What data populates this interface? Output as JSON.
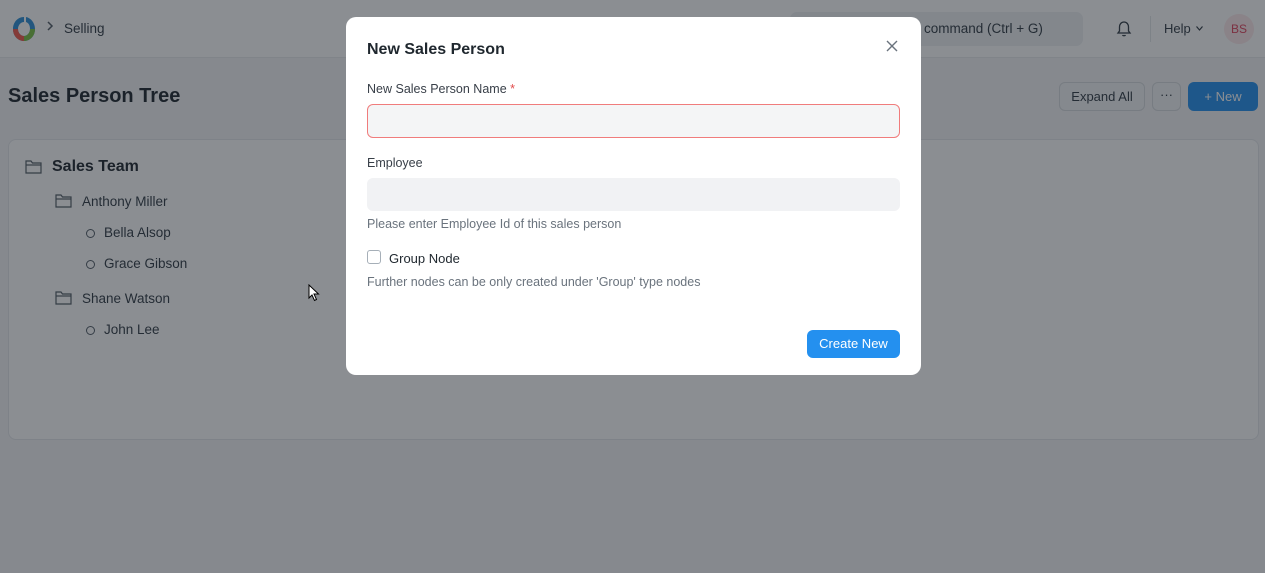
{
  "navbar": {
    "breadcrumb": "Selling",
    "search_placeholder": "command (Ctrl + G)",
    "help_label": "Help",
    "avatar_initials": "BS",
    "icons": [
      "app-logo-icon",
      "chevron-right-icon",
      "bell-icon",
      "chevron-down-icon"
    ]
  },
  "page": {
    "title": "Sales Person Tree",
    "expand_all_label": "Expand All",
    "more_label": "···",
    "new_label": "+ New"
  },
  "tree": {
    "root": "Sales Team",
    "nodes": [
      {
        "label": "Anthony Miller",
        "type": "group"
      },
      {
        "label": "Bella Alsop",
        "type": "leaf"
      },
      {
        "label": "Grace Gibson",
        "type": "leaf"
      },
      {
        "label": "Shane Watson",
        "type": "group"
      },
      {
        "label": "John Lee",
        "type": "leaf"
      }
    ]
  },
  "modal": {
    "title": "New Sales Person",
    "name_label": "New Sales Person Name",
    "required_mark": "*",
    "name_value": "",
    "employee_label": "Employee",
    "employee_value": "",
    "employee_help": "Please enter Employee Id of this sales person",
    "group_node_label": "Group Node",
    "group_node_checked": false,
    "group_help": "Further nodes can be only created under 'Group' type nodes",
    "create_label": "Create New"
  },
  "colors": {
    "primary": "#2490ef",
    "required": "#e24c4c",
    "avatar_text": "#e0445e",
    "overlay": "rgba(24,30,38,0.5)"
  }
}
